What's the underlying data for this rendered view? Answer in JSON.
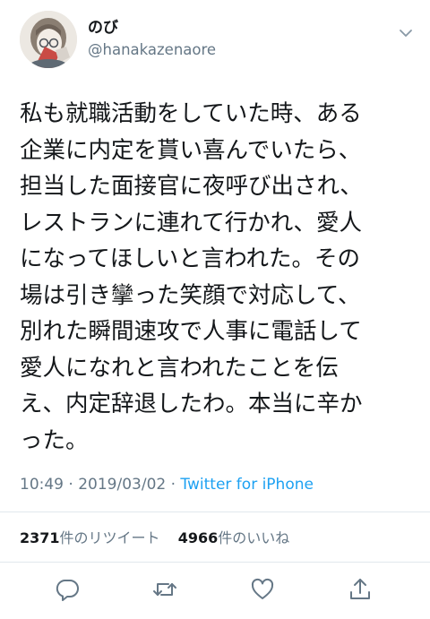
{
  "user": {
    "display_name": "のび",
    "handle": "@hanakazenaore"
  },
  "tweet": {
    "lines": [
      "私も就職活動をしていた時、ある",
      "企業に内定を貰い喜んでいたら、",
      "担当した面接官に夜呼び出され、",
      "レストランに連れて行かれ、愛人",
      "になってほしいと言われた。その",
      "場は引き攣った笑顔で対応して、",
      "別れた瞬間速攻で人事に電話して",
      "愛人になれと言われたことを伝",
      "え、内定辞退したわ。本当に辛か",
      "った。"
    ]
  },
  "meta": {
    "time": "10:49",
    "sep1": " · ",
    "date": "2019/03/02",
    "sep2": " · ",
    "source": "Twitter for iPhone"
  },
  "stats": {
    "retweets_count": "2371",
    "retweets_label": "件のリツイート",
    "likes_count": "4966",
    "likes_label": "件のいいね"
  },
  "icons": {
    "reply": "reply-icon",
    "retweet": "retweet-icon",
    "like": "heart-icon",
    "share": "share-icon",
    "more": "chevron-down-icon"
  },
  "colors": {
    "text": "#14171a",
    "secondary": "#657786",
    "link": "#1da1f2",
    "divider": "#e1e8ed"
  }
}
